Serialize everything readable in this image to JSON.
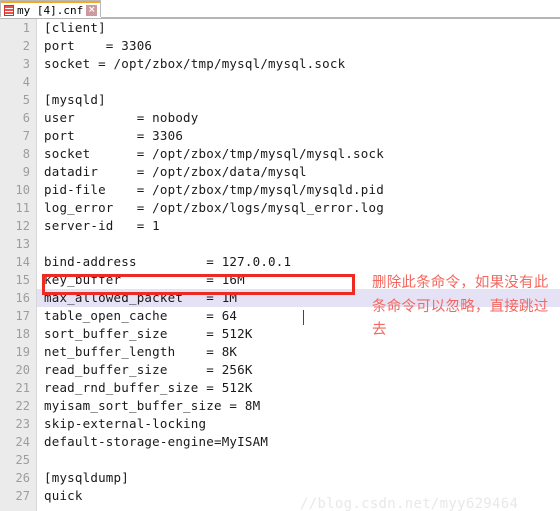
{
  "window": {
    "title": "my [4].cnf"
  },
  "tab": {
    "label": "my [4].cnf",
    "close_label": "×",
    "icon": "cnf-file-icon",
    "accent_color": "#f5a623"
  },
  "editor": {
    "gutter_bg": "#ebebeb",
    "current_line": 16,
    "current_line_highlight": "#e6e2f5",
    "caret_color": "#5b2d8e",
    "lines": [
      {
        "n": "1",
        "text": "[client]"
      },
      {
        "n": "2",
        "text": "port    = 3306"
      },
      {
        "n": "3",
        "text": "socket = /opt/zbox/tmp/mysql/mysql.sock"
      },
      {
        "n": "4",
        "text": ""
      },
      {
        "n": "5",
        "text": "[mysqld]"
      },
      {
        "n": "6",
        "text": "user        = nobody"
      },
      {
        "n": "7",
        "text": "port        = 3306"
      },
      {
        "n": "8",
        "text": "socket      = /opt/zbox/tmp/mysql/mysql.sock"
      },
      {
        "n": "9",
        "text": "datadir     = /opt/zbox/data/mysql"
      },
      {
        "n": "10",
        "text": "pid-file    = /opt/zbox/tmp/mysql/mysqld.pid"
      },
      {
        "n": "11",
        "text": "log_error   = /opt/zbox/logs/mysql_error.log"
      },
      {
        "n": "12",
        "text": "server-id   = 1"
      },
      {
        "n": "13",
        "text": ""
      },
      {
        "n": "14",
        "text": "bind-address         = 127.0.0.1"
      },
      {
        "n": "15",
        "text": "key_buffer           = 16M"
      },
      {
        "n": "16",
        "text": "max_allowed_packet   = 1M"
      },
      {
        "n": "17",
        "text": "table_open_cache     = 64"
      },
      {
        "n": "18",
        "text": "sort_buffer_size     = 512K"
      },
      {
        "n": "19",
        "text": "net_buffer_length    = 8K"
      },
      {
        "n": "20",
        "text": "read_buffer_size     = 256K"
      },
      {
        "n": "21",
        "text": "read_rnd_buffer_size = 512K"
      },
      {
        "n": "22",
        "text": "myisam_sort_buffer_size = 8M"
      },
      {
        "n": "23",
        "text": "skip-external-locking"
      },
      {
        "n": "24",
        "text": "default-storage-engine=MyISAM"
      },
      {
        "n": "25",
        "text": ""
      },
      {
        "n": "26",
        "text": "[mysqldump]"
      },
      {
        "n": "27",
        "text": "quick"
      }
    ]
  },
  "annotations": {
    "redbox": {
      "color": "#ee2b23",
      "targets_line": "14"
    },
    "note": {
      "text": "删除此条命令，如果没有此条命令可以忽略，直接跳过去",
      "color": "#f4675f"
    }
  },
  "watermark": {
    "text": "//blog.csdn.net/myy629464",
    "color": "#e8e8e8"
  }
}
